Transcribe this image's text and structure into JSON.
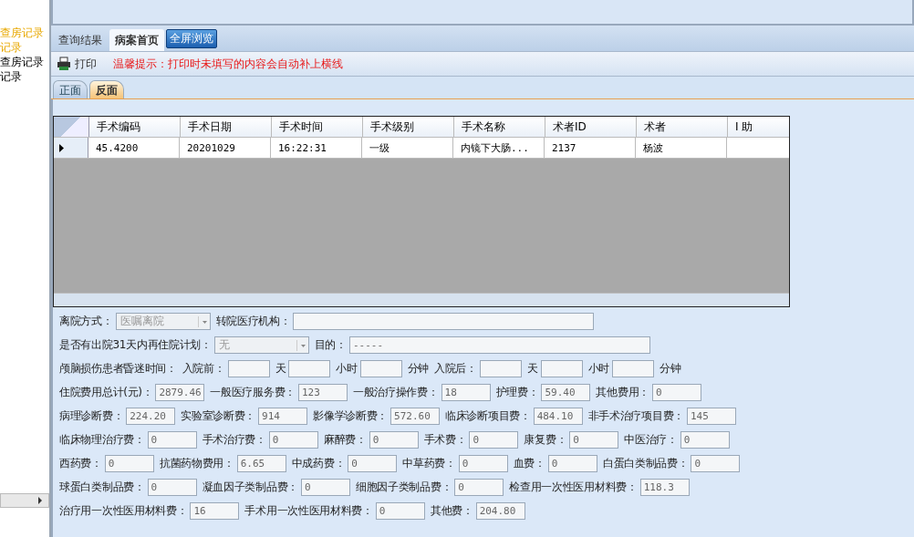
{
  "sidebar": {
    "items": [
      {
        "label": "查房记录",
        "selected": true
      },
      {
        "label": "记录",
        "selected": true
      },
      {
        "label": "查房记录",
        "selected": false
      },
      {
        "label": "记录",
        "selected": false
      }
    ]
  },
  "tabs": [
    {
      "label": "查询结果",
      "kind": "tab",
      "selected": false
    },
    {
      "label": "病案首页",
      "kind": "tab",
      "selected": true
    },
    {
      "label": "全屏浏览",
      "kind": "button",
      "selected": false
    }
  ],
  "toolbar": {
    "print": "打印",
    "hint": "温馨提示：打印时未填写的内容会自动补上横线"
  },
  "subtabs": [
    {
      "label": "正面",
      "selected": false
    },
    {
      "label": "反面",
      "selected": true
    }
  ],
  "table": {
    "columns": [
      "手术编码",
      "手术日期",
      "手术时间",
      "手术级别",
      "手术名称",
      "术者ID",
      "术者",
      "I 助"
    ],
    "rows": [
      {
        "current": true,
        "cells": [
          "45.4200",
          "20201029",
          "16:22:31",
          "一级",
          "内镜下大肠...",
          "2137",
          "杨波",
          null
        ]
      }
    ]
  },
  "form_rows": [
    {
      "items": [
        {
          "label": "离院方式：",
          "kind": "select",
          "value": "医嘱离院"
        },
        {
          "label": "转院医疗机构：",
          "kind": "long"
        }
      ]
    },
    {
      "items": [
        {
          "label": "是否有出院31天内再住院计划：",
          "kind": "select",
          "value": "无"
        },
        {
          "label": "目的：",
          "kind": "long",
          "value": "-----"
        }
      ]
    },
    {
      "items": [
        {
          "label": "颅脑损伤患者昏迷时间：",
          "kind": "none"
        },
        {
          "label": "入院前：",
          "kind": "small"
        },
        {
          "label": "天",
          "kind": "small"
        },
        {
          "label": "小时",
          "kind": "small"
        },
        {
          "label": "分钟",
          "kind": "none"
        },
        {
          "label": "入院后：",
          "kind": "small"
        },
        {
          "label": "天",
          "kind": "small"
        },
        {
          "label": "小时",
          "kind": "small"
        },
        {
          "label": "分钟",
          "kind": "none"
        }
      ]
    },
    {
      "items": [
        {
          "label": "住院费用总计(元)：",
          "kind": "fee",
          "value": "2879.46"
        },
        {
          "label": "一般医疗服务费：",
          "kind": "fee",
          "value": "123"
        },
        {
          "label": "一般治疗操作费：",
          "kind": "fee",
          "value": "18"
        },
        {
          "label": "护理费：",
          "kind": "fee",
          "value": "59.40"
        },
        {
          "label": "其他费用：",
          "kind": "fee",
          "value": "0"
        }
      ]
    },
    {
      "items": [
        {
          "label": "病理诊断费：",
          "kind": "fee",
          "value": "224.20"
        },
        {
          "label": "实验室诊断费：",
          "kind": "fee",
          "value": "914"
        },
        {
          "label": "影像学诊断费：",
          "kind": "fee",
          "value": "572.60"
        },
        {
          "label": "临床诊断项目费：",
          "kind": "fee",
          "value": "484.10"
        },
        {
          "label": "非手术治疗项目费：",
          "kind": "fee",
          "value": "145"
        }
      ]
    },
    {
      "items": [
        {
          "label": "临床物理治疗费：",
          "kind": "fee",
          "value": "0"
        },
        {
          "label": "手术治疗费：",
          "kind": "fee",
          "value": "0"
        },
        {
          "label": "麻醉费：",
          "kind": "fee",
          "value": "0"
        },
        {
          "label": "手术费：",
          "kind": "fee",
          "value": "0"
        },
        {
          "label": "康复费：",
          "kind": "fee",
          "value": "0"
        },
        {
          "label": "中医治疗：",
          "kind": "fee",
          "value": "0"
        }
      ]
    },
    {
      "items": [
        {
          "label": "西药费：",
          "kind": "fee",
          "value": "0"
        },
        {
          "label": "抗菌药物费用：",
          "kind": "fee",
          "value": "6.65"
        },
        {
          "label": "中成药费：",
          "kind": "fee",
          "value": "0"
        },
        {
          "label": "中草药费：",
          "kind": "fee",
          "value": "0"
        },
        {
          "label": "血费：",
          "kind": "fee",
          "value": "0"
        },
        {
          "label": "白蛋白类制品费：",
          "kind": "fee",
          "value": "0"
        }
      ]
    },
    {
      "items": [
        {
          "label": "球蛋白类制品费：",
          "kind": "fee",
          "value": "0"
        },
        {
          "label": "凝血因子类制品费：",
          "kind": "fee",
          "value": "0"
        },
        {
          "label": "细胞因子类制品费：",
          "kind": "fee",
          "value": "0"
        },
        {
          "label": "检查用一次性医用材料费：",
          "kind": "fee",
          "value": "118.3"
        }
      ]
    },
    {
      "items": [
        {
          "label": "治疗用一次性医用材料费：",
          "kind": "fee",
          "value": "16"
        },
        {
          "label": "手术用一次性医用材料费：",
          "kind": "fee",
          "value": "0"
        },
        {
          "label": "其他费：",
          "kind": "fee",
          "value": "204.80"
        }
      ]
    }
  ]
}
